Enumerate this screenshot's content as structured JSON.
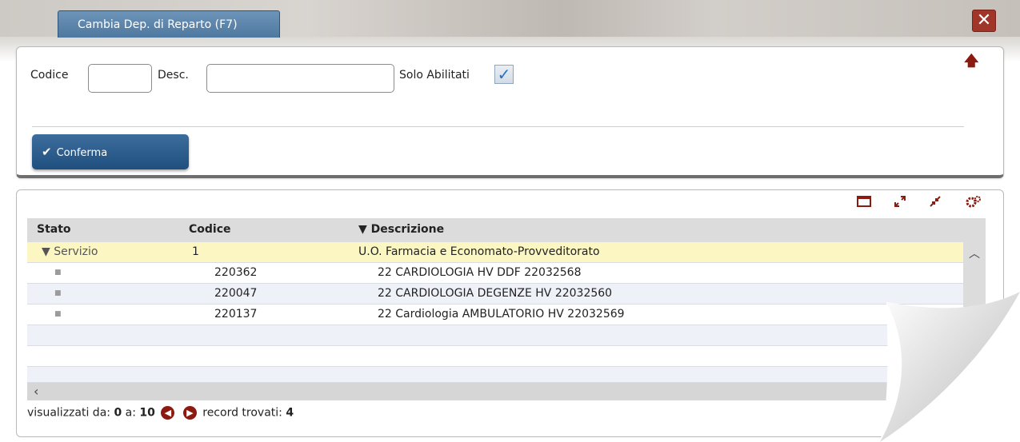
{
  "dialog": {
    "title": "Cambia Dep. di Reparto (F7)",
    "close_icon": "close-icon"
  },
  "filter": {
    "codice_label": "Codice",
    "codice_value": "",
    "desc_label": "Desc.",
    "desc_value": "",
    "solo_abilitati_label": "Solo Abilitati",
    "solo_abilitati_checked": true,
    "collapse_icon": "arrow-up-icon",
    "confirm_label": "Conferma",
    "confirm_icon": "check-icon"
  },
  "toolbar": {
    "icons": [
      "window-icon",
      "expand-icon",
      "collapse-icon",
      "settings-icon"
    ]
  },
  "grid": {
    "columns": [
      "Stato",
      "Codice",
      "▼ Descrizione"
    ],
    "rows": [
      {
        "stato": "▼ Servizio",
        "codice": "1",
        "descrizione": "U.O. Farmacia e Economato-Provveditorato"
      },
      {
        "stato": "■",
        "codice": "220362",
        "descrizione": "22 CARDIOLOGIA HV DDF 22032568"
      },
      {
        "stato": "■",
        "codice": "220047",
        "descrizione": "22 CARDIOLOGIA DEGENZE HV 22032560"
      },
      {
        "stato": "■",
        "codice": "220137",
        "descrizione": "22 Cardiologia AMBULATORIO HV 22032569"
      }
    ]
  },
  "pager": {
    "range_label": "visualizzati da:",
    "from_value": "0",
    "to_label": "a:",
    "to_value": "10",
    "found_label": "record trovati:",
    "found_value": "4"
  },
  "colors": {
    "accent": "#8b1a10",
    "tab": "#5a81a8",
    "confirm": "#1f4f7f",
    "selected_row": "#fbf6c2"
  }
}
